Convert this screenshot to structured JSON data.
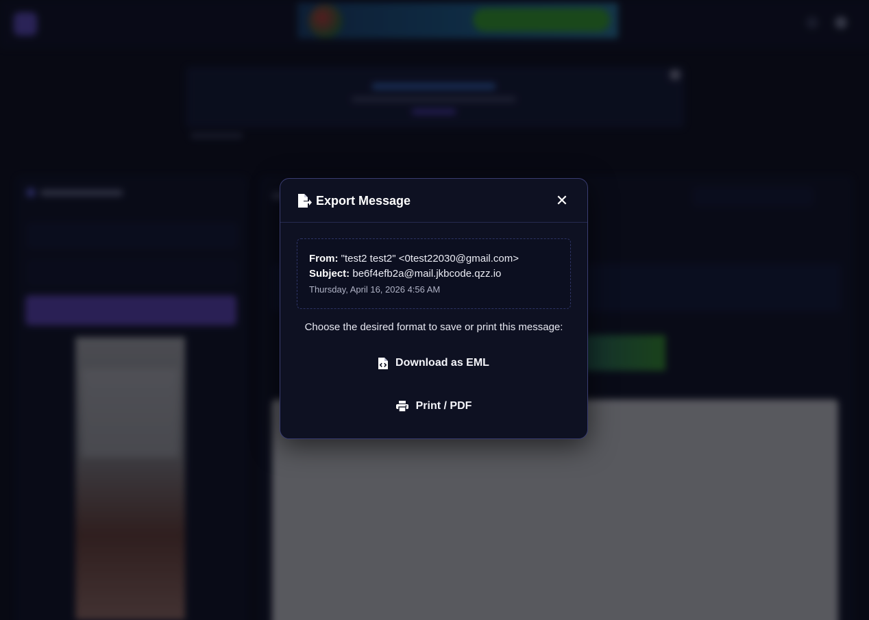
{
  "modal": {
    "title": "Export Message",
    "close_glyph": "✕",
    "from_label": "From:",
    "from_value": "\"test2 test2\" <0test22030@gmail.com>",
    "subject_label": "Subject:",
    "subject_value": "be6f4efb2a@mail.jkbcode.qzz.io",
    "date": "Thursday, April 16, 2026 4:56 AM",
    "prompt": "Choose the desired format to save or print this message:",
    "actions": [
      {
        "label": "Download as EML",
        "icon": "file-code-icon"
      },
      {
        "label": "Print / PDF",
        "icon": "printer-icon"
      }
    ],
    "title_icon": "file-export-icon"
  },
  "colors": {
    "modal_bg": "#0e1122",
    "modal_border": "#3a3d72",
    "accent": "#6d4fd2",
    "page_bg": "#0b0d1a"
  }
}
